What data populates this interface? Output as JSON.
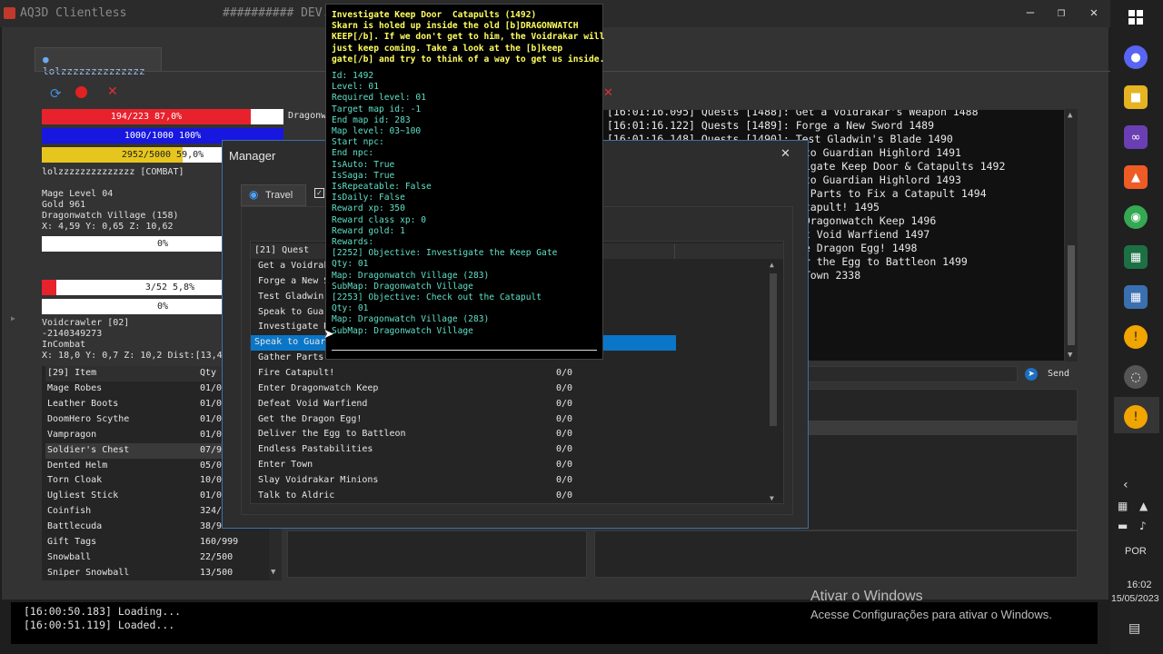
{
  "window": {
    "title": "AQ3D Clientless",
    "subtitle": "########## DEV."
  },
  "account_tab": "lolzzzzzzzzzzzzzz",
  "player": {
    "hp": "194/223 87,0%",
    "mp": "1000/1000 100%",
    "xp": "2952/5000 59,0%",
    "name_line": "lolzzzzzzzzzzzzzz [COMBAT]",
    "class_line": "Mage Level 04",
    "gold_line": "Gold 961",
    "map_line": "Dragonwatch Village (158)",
    "pos_line": "X: 4,59 Y: 0,65 Z: 10,62",
    "bar_pct": "0%"
  },
  "target": {
    "hp": "3/52 5,8%",
    "bar_pct": "0%",
    "name": "Voidcrawler [02]",
    "id": "-2140349273",
    "state": "InCombat",
    "pos": "X: 18,0 Y: 0,7 Z: 10,2 Dist:[13,4]"
  },
  "side_label": "Dragonw",
  "items": {
    "header_name": "[29] Item",
    "header_qty": "Qty",
    "rows": [
      {
        "name": "Mage Robes",
        "qty": "01/0"
      },
      {
        "name": "Leather Boots",
        "qty": "01/0"
      },
      {
        "name": "DoomHero Scythe",
        "qty": "01/0"
      },
      {
        "name": "Vampragon",
        "qty": "01/0"
      },
      {
        "name": "Soldier's Chest",
        "qty": "07/9"
      },
      {
        "name": "Dented Helm",
        "qty": "05/0"
      },
      {
        "name": "Torn Cloak",
        "qty": "10/0"
      },
      {
        "name": "Ugliest Stick",
        "qty": "01/0"
      },
      {
        "name": "Coinfish",
        "qty": "324/"
      },
      {
        "name": "Battlecuda",
        "qty": "38/9"
      },
      {
        "name": "Gift Tags",
        "qty": "160/999"
      },
      {
        "name": "Snowball",
        "qty": "22/500"
      },
      {
        "name": "Sniper Snowball",
        "qty": "13/500"
      }
    ]
  },
  "log": [
    "[16:01:16.095] Quests [1488]: Get a Voidrakar's Weapon 1488",
    "[16:01:16.122] Quests [1489]: Forge a New Sword 1489",
    "[16:01:16.148] Quests [1490]: Test Gladwin's Blade 1490",
    "k to Guardian Highlord 1491",
    "stigate Keep Door & Catapults 1492",
    "k to Guardian Highlord 1493",
    "er Parts to Fix a Catapult 1494",
    " Catapult! 1495",
    "r Dragonwatch Keep 1496",
    "eat Void Warfiend 1497",
    "the Dragon Egg! 1498",
    "ver the Egg to Battleon 1499",
    "r Town 2338"
  ],
  "send_label": "Send",
  "console": [
    "[16:00:50.183] Loading...",
    "[16:00:51.119] Loaded..."
  ],
  "manager": {
    "title": "Manager",
    "travel_tab": "Travel",
    "quest_header": "[21] Quest",
    "quests": [
      {
        "name": "Get a Voidraka",
        "progress": ""
      },
      {
        "name": "Forge a New Sw",
        "progress": ""
      },
      {
        "name": "Test Gladwin's",
        "progress": ""
      },
      {
        "name": "Speak to Guard",
        "progress": ""
      },
      {
        "name": "Investigate Ke",
        "progress": ""
      },
      {
        "name": "Speak to Guard",
        "progress": ""
      },
      {
        "name": "Gather Parts t",
        "progress": ""
      },
      {
        "name": "Fire Catapult!",
        "progress": "0/0"
      },
      {
        "name": "Enter Dragonwatch Keep",
        "progress": "0/0"
      },
      {
        "name": "Defeat Void Warfiend",
        "progress": "0/0"
      },
      {
        "name": "Get the Dragon Egg!",
        "progress": "0/0"
      },
      {
        "name": "Deliver the Egg to Battleon",
        "progress": "0/0"
      },
      {
        "name": "Endless Pastabilities",
        "progress": "0/0"
      },
      {
        "name": "Enter Town",
        "progress": "0/0"
      },
      {
        "name": "Slay Voidrakar Minions",
        "progress": "0/0"
      },
      {
        "name": "Talk to Aldric",
        "progress": "0/0"
      }
    ],
    "selected_index": 5
  },
  "tooltip": {
    "header": "Investigate Keep Door  Catapults (1492)\nSkarn is holed up inside the old [b]DRAGONWATCH\nKEEP[/b]. If we don't get to him, the Voidrakar will\njust keep coming. Take a look at the [b]keep\ngate[/b] and try to think of a way to get us inside.",
    "body": "Id: 1492\nLevel: 01\nRequired level: 01\nTarget map id: -1\nEnd map id: 283\nMap level: 03~100\nStart npc:\nEnd npc:\nIsAuto: True\nIsSaga: True\nIsRepeatable: False\nIsDaily: False\nReward xp: 350\nReward class xp: 0\nReward gold: 1\nRewards:\n[2252] Objective: Investigate the Keep Gate\nQty: 01\nMap: Dragonwatch Village (283)\nSubMap: Dragonwatch Village\n[2253] Objective: Check out the Catapult\nQty: 01\nMap: Dragonwatch Village (283)\nSubMap: Dragonwatch Village"
  },
  "watermark": {
    "title": "Ativar o Windows",
    "sub": "Acesse Configurações para ativar o Windows."
  },
  "tray": {
    "lang": "POR",
    "time": "16:02",
    "date": "15/05/2023"
  },
  "colors": {
    "hp": "#e8222c",
    "mp": "#1717e0",
    "xp": "#e6c61e",
    "selected": "#0a76c8"
  }
}
